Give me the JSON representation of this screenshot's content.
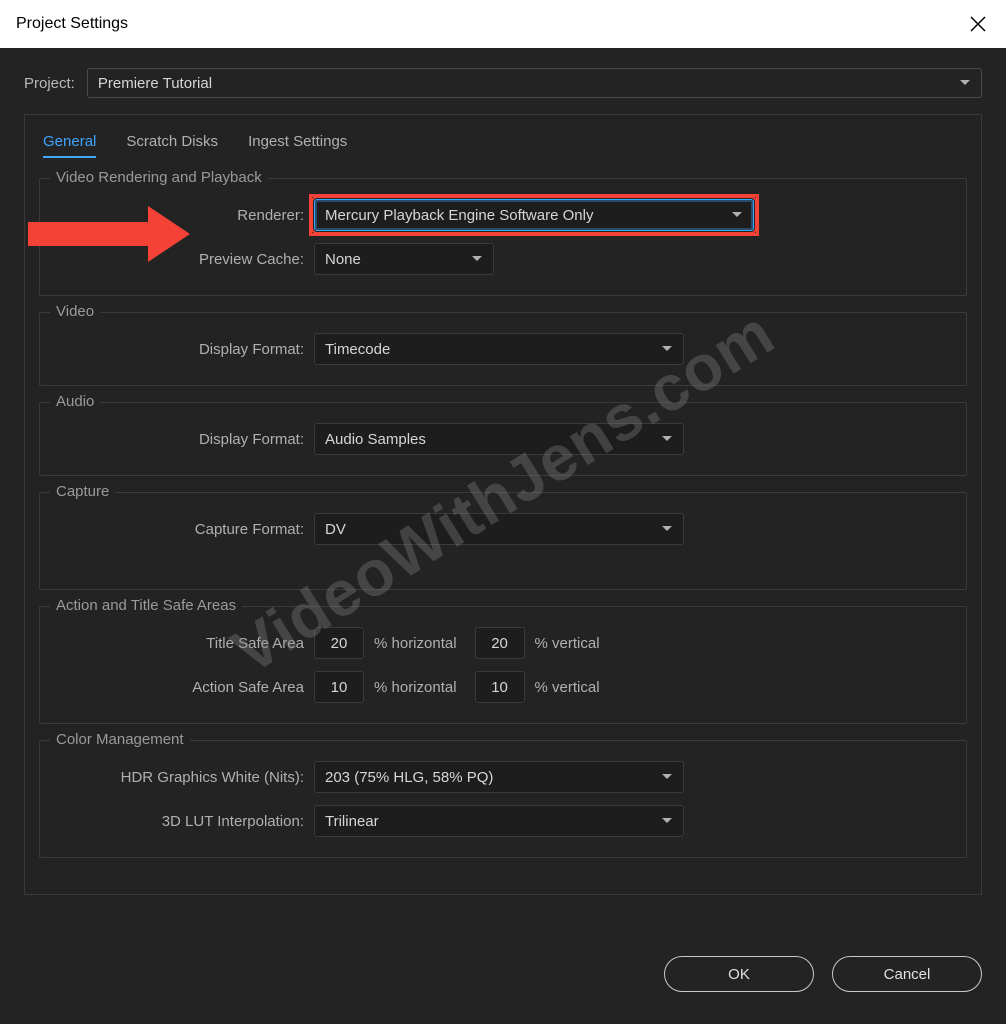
{
  "window": {
    "title": "Project Settings"
  },
  "project": {
    "label": "Project:",
    "value": "Premiere Tutorial"
  },
  "tabs": {
    "general": "General",
    "scratch": "Scratch Disks",
    "ingest": "Ingest Settings"
  },
  "sections": {
    "rendering": {
      "title": "Video Rendering and Playback",
      "renderer_label": "Renderer:",
      "renderer_value": "Mercury Playback Engine Software Only",
      "preview_cache_label": "Preview Cache:",
      "preview_cache_value": "None"
    },
    "video": {
      "title": "Video",
      "display_format_label": "Display Format:",
      "display_format_value": "Timecode"
    },
    "audio": {
      "title": "Audio",
      "display_format_label": "Display Format:",
      "display_format_value": "Audio Samples"
    },
    "capture": {
      "title": "Capture",
      "capture_format_label": "Capture Format:",
      "capture_format_value": "DV"
    },
    "safe_areas": {
      "title": "Action and Title Safe Areas",
      "title_safe_label": "Title Safe Area",
      "title_safe_h": "20",
      "title_safe_v": "20",
      "action_safe_label": "Action Safe Area",
      "action_safe_h": "10",
      "action_safe_v": "10",
      "pct_h": "% horizontal",
      "pct_v": "% vertical"
    },
    "color": {
      "title": "Color Management",
      "hdr_label": "HDR Graphics White (Nits):",
      "hdr_value": "203 (75% HLG, 58% PQ)",
      "lut_label": "3D LUT Interpolation:",
      "lut_value": "Trilinear"
    }
  },
  "buttons": {
    "ok": "OK",
    "cancel": "Cancel"
  },
  "watermark": "VideoWithJens.com"
}
